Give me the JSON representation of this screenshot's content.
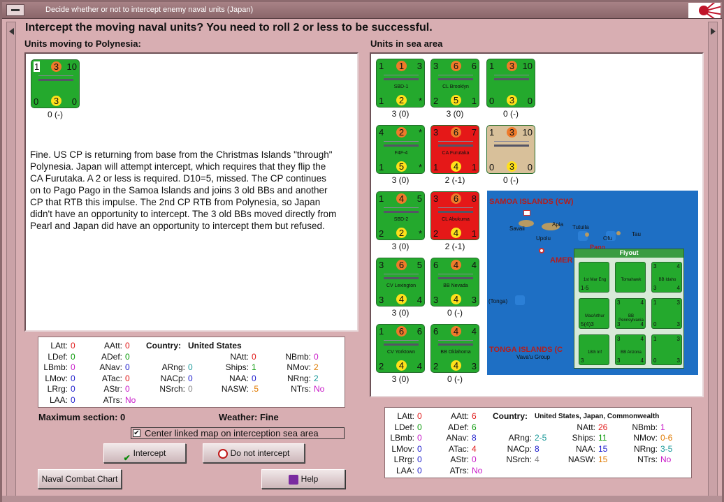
{
  "window": {
    "title": "Decide whether or not to intercept enemy naval units (Japan)"
  },
  "question": "Intercept the moving naval units?  You need to roll 2 or less to be successful.",
  "moving": {
    "heading": "Units moving to Polynesia:",
    "unit": {
      "tl": "1",
      "tc": "3",
      "tr": "10",
      "bl": "0",
      "bc": "3",
      "br": "0",
      "caption": "0 (-)"
    },
    "comment": "Fine.  US CP is returning from base from the Christmas Islands \"through\" Polynesia.  Japan will attempt intercept, which requires that they flip the CA Furutaka.  A 2 or less is required.  D10=5, missed.  The CP continues on to Pago Pago in the Samoa Islands and joins 3 old BBs and another CP that RTB this impulse.  The 2nd CP RTB from Polynesia, so Japan didn't have an opportunity to intercept.  The 3 old BBs moved directly from Pearl and Japan did have an opportunity to intercept them but refused."
  },
  "sea": {
    "heading": "Units in sea area",
    "units": [
      {
        "tl": "1",
        "tc": "1",
        "tr": "3",
        "bl": "1",
        "bc": "2",
        "br": "*",
        "name": "SBD-1",
        "caption": "3 (0)",
        "color": "green"
      },
      {
        "tl": "3",
        "tc": "6",
        "tr": "6",
        "bl": "2",
        "bc": "5",
        "br": "1",
        "name": "CL Brooklyn",
        "caption": "3 (0)",
        "color": "green"
      },
      {
        "tl": "1",
        "tc": "3",
        "tr": "10",
        "bl": "0",
        "bc": "3",
        "br": "0",
        "name": "",
        "caption": "0 (-)",
        "color": "green"
      },
      {
        "tl": "4",
        "tc": "2",
        "tr": "*",
        "bl": "1",
        "bc": "5",
        "br": "*",
        "name": "F4F-4",
        "caption": "3 (0)",
        "color": "green"
      },
      {
        "tl": "3",
        "tc": "6",
        "tr": "7",
        "bl": "1",
        "bc": "4",
        "br": "1",
        "name": "CA Furutaka",
        "caption": "2 (-1)",
        "color": "red"
      },
      {
        "tl": "1",
        "tc": "3",
        "tr": "10",
        "bl": "0",
        "bc": "3",
        "br": "0",
        "name": "",
        "caption": "0 (-)",
        "color": "tan"
      },
      {
        "tl": "1",
        "tc": "4",
        "tr": "5",
        "bl": "2",
        "bc": "2",
        "br": "*",
        "name": "SBD-2",
        "caption": "3 (0)",
        "color": "green"
      },
      {
        "tl": "3",
        "tc": "6",
        "tr": "8",
        "bl": "2",
        "bc": "4",
        "br": "1",
        "name": "CL Abukuma",
        "caption": "2 (-1)",
        "color": "red"
      },
      {
        "tl": "3",
        "tc": "6",
        "tr": "5",
        "bl": "3",
        "bc": "4",
        "br": "4",
        "name": "CV Lexington",
        "caption": "3 (0)",
        "color": "green"
      },
      {
        "tl": "6",
        "tc": "4",
        "tr": "4",
        "bl": "3",
        "bc": "4",
        "br": "3",
        "name": "BB Nevada",
        "caption": "0 (-)",
        "color": "green"
      },
      {
        "tl": "1",
        "tc": "6",
        "tr": "6",
        "bl": "2",
        "bc": "4",
        "br": "4",
        "name": "CV Yorktown",
        "caption": "3 (0)",
        "color": "green"
      },
      {
        "tl": "6",
        "tc": "4",
        "tr": "4",
        "bl": "2",
        "bc": "4",
        "br": "3",
        "name": "BB Oklahoma",
        "caption": "0 (-)",
        "color": "green"
      }
    ]
  },
  "map": {
    "samoa": "SAMOA ISLANDS (CW)",
    "tonga": "TONGA ISLANDS (C",
    "amer": "AMER",
    "savaii": "Savaii",
    "apia": "Apia",
    "upolu": "Upolu",
    "tutuila": "Tutuila",
    "ofu": "Ofu",
    "tau": "Tau",
    "pago": "Pago",
    "tonga_small": "(Tonga)",
    "vavau": "Vava'u Group",
    "flyout": "Flyout",
    "flyout_units": [
      {
        "t": "",
        "r": "",
        "b": "1-5",
        "rb": "",
        "lbl": "1st Mar Eng"
      },
      {
        "t": "",
        "r": "",
        "b": "",
        "rb": "",
        "lbl": "Tomahawk"
      },
      {
        "t": "3",
        "r": "4",
        "b": "3",
        "rb": "4",
        "lbl": "BB Idaho"
      },
      {
        "t": "",
        "r": "",
        "b": "5(4)3",
        "rb": "",
        "lbl": "MacArthur"
      },
      {
        "t": "3",
        "r": "4",
        "b": "3",
        "rb": "4",
        "lbl": "BB Pennsylvania"
      },
      {
        "t": "1",
        "r": "3",
        "b": "0",
        "rb": "3",
        "lbl": ""
      },
      {
        "t": "",
        "r": "",
        "b": "3",
        "rb": "",
        "lbl": "18th Inf"
      },
      {
        "t": "3",
        "r": "4",
        "b": "3",
        "rb": "4",
        "lbl": "BB Arizona"
      },
      {
        "t": "1",
        "r": "3",
        "b": "0",
        "rb": "3",
        "lbl": ""
      }
    ]
  },
  "left_stats": {
    "LAtt": "0",
    "LDef": "0",
    "LBmb": "0",
    "LMov": "0",
    "LRrg": "0",
    "LAA": "0",
    "AAtt": "0",
    "ADef": "0",
    "ANav": "0",
    "ATac": "0",
    "AStr": "0",
    "ATrs": "No",
    "country_label": "Country:",
    "country": "United States",
    "ARng": "0",
    "NACp": "0",
    "NSrch": "0",
    "NAtt": "0",
    "Ships": "1",
    "NAA": "0",
    "NASW": ".5",
    "NBmb": "0",
    "NMov": "2",
    "NRng": "2",
    "NTrs": "No"
  },
  "right_stats": {
    "LAtt": "0",
    "LDef": "0",
    "LBmb": "0",
    "LMov": "0",
    "LRrg": "0",
    "LAA": "0",
    "AAtt": "6",
    "ADef": "6",
    "ANav": "8",
    "ATac": "4",
    "AStr": "0",
    "ATrs": "No",
    "country_label": "Country:",
    "country": "United States, Japan, Commonwealth",
    "ARng": "2-5",
    "NACp": "8",
    "NSrch": "4",
    "NAtt": "26",
    "Ships": "11",
    "NAA": "15",
    "NASW": "15",
    "NBmb": "1",
    "NMov": "0-6",
    "NRng": "3-5",
    "NTrs": "No"
  },
  "max_section": "Maximum section: 0",
  "weather": "Weather:  Fine",
  "center_map_label": "Center linked map on interception sea area",
  "buttons": {
    "intercept": "Intercept",
    "no_intercept": "Do not intercept",
    "chart": "Naval Combat Chart",
    "help": "Help"
  },
  "colors": {
    "window_bg": "#d8aeb2",
    "unit_green": "#24a92d",
    "unit_red": "#e51818",
    "sea_blue": "#1e6fc4"
  }
}
